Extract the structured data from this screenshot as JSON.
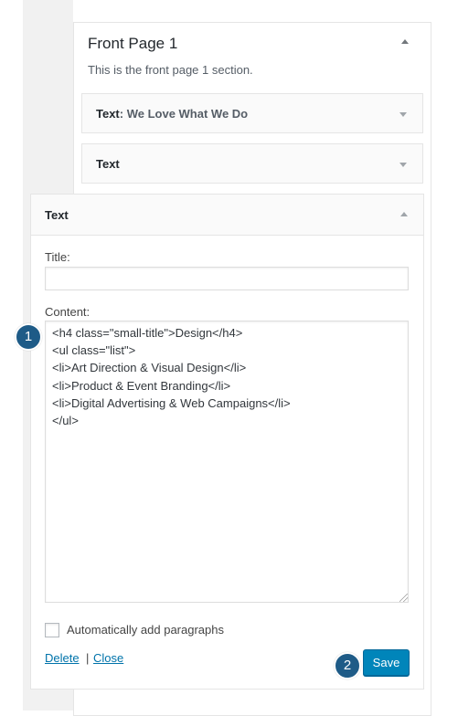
{
  "section": {
    "title": "Front Page 1",
    "description": "This is the front page 1 section."
  },
  "collapsed_widgets": [
    {
      "type_label": "Text",
      "title": ": We Love What We Do"
    },
    {
      "type_label": "Text",
      "title": ""
    }
  ],
  "open_widget": {
    "header": "Text",
    "title_label": "Title:",
    "title_value": "",
    "content_label": "Content:",
    "content_lines": [
      "<h4 class=\"small-title\">Design</h4>",
      "<ul class=\"list\">",
      "<li>Art Direction & Visual Design</li>",
      "<li>Product & Event Branding</li>",
      "<li>Digital Advertising & Web Campaigns</li>",
      "</ul>"
    ],
    "checkbox_label": "Automatically add paragraphs",
    "checkbox_checked": false,
    "delete_label": "Delete",
    "separator": "|",
    "close_label": "Close",
    "save_label": "Save"
  },
  "badges": [
    "1",
    "2"
  ],
  "colors": {
    "accent": "#0085ba",
    "link": "#0073aa",
    "badge": "#1e5b87"
  }
}
